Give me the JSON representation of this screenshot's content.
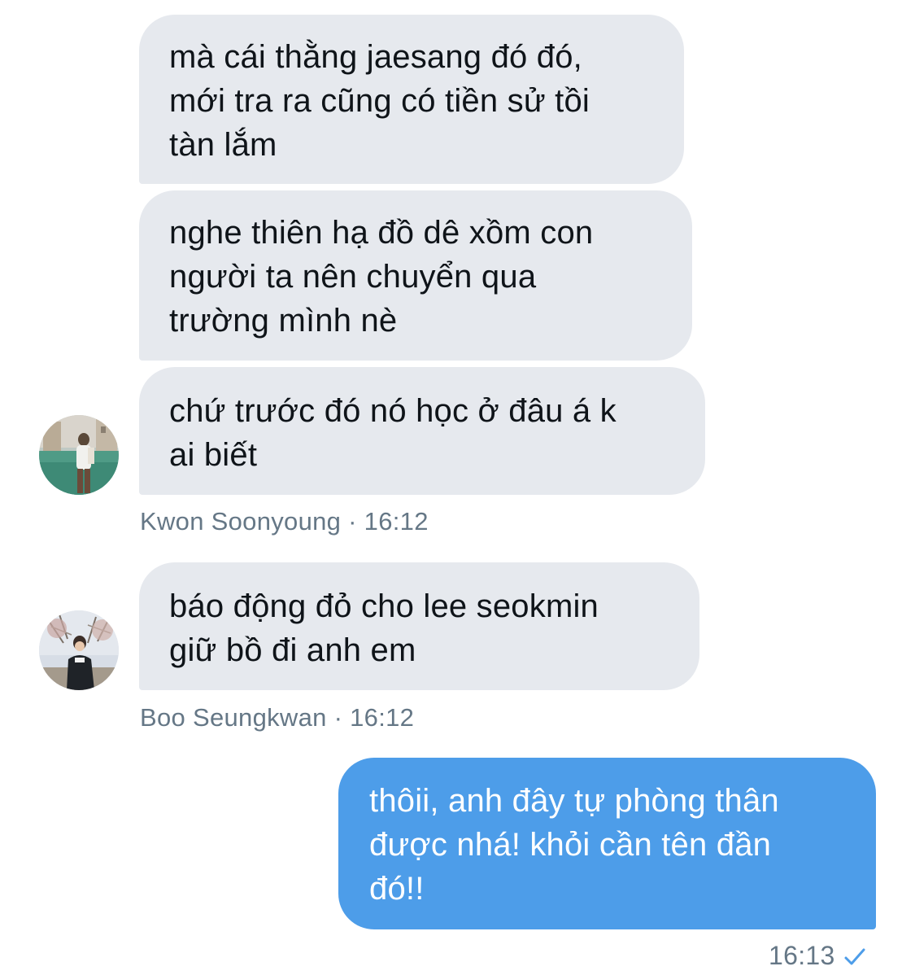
{
  "conversation": {
    "messages": [
      {
        "text": "mà cái thằng jaesang đó đó,\nmới tra ra cũng có tiền sử tồi\ntàn lắm"
      },
      {
        "text": "nghe thiên hạ đồ dê xồm con\nngười ta nên chuyển qua\ntrường mình nè"
      },
      {
        "text": "chứ trước đó nó học ở đâu á k\nai biết"
      },
      {
        "text": "báo động đỏ cho lee seokmin\ngiữ bồ đi anh em"
      },
      {
        "text": "thôii, anh đây tự phòng thân\nđược nhá! khỏi cần tên đần\nđó!!"
      }
    ],
    "meta": {
      "group1": "Kwon Soonyoung · 16:12",
      "group2": "Boo Seungkwan · 16:12",
      "outgoing_time": "16:13"
    },
    "icons": {
      "avatar1": "avatar-kwon-soonyoung",
      "avatar2": "avatar-boo-seungkwan",
      "read_receipt": "checkmark-icon"
    },
    "colors": {
      "incoming_bubble": "#e6e9ee",
      "outgoing_bubble": "#4d9de9",
      "meta_text": "#657786"
    }
  }
}
